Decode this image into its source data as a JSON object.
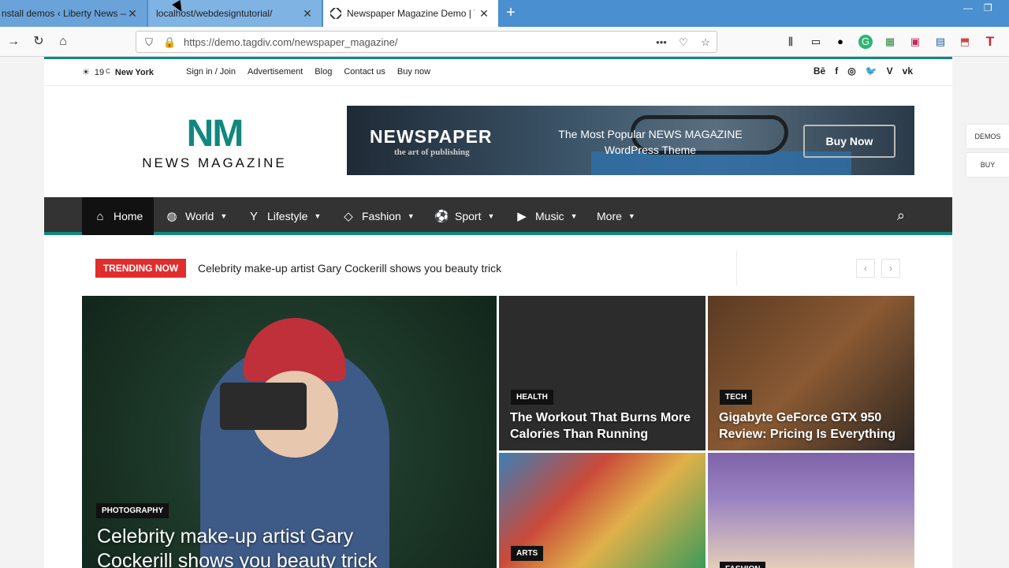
{
  "browser": {
    "tabs": [
      {
        "title": "nstall demos ‹ Liberty News —"
      },
      {
        "title": "localhost/webdesigntutorial/"
      },
      {
        "title": "Newspaper Magazine Demo | T"
      }
    ],
    "new_tab": "+",
    "url_host": "https://demo.tagdiv.com",
    "url_path": "/newspaper_magazine/",
    "url_more": "•••"
  },
  "topbar": {
    "temperature": "19",
    "unit": "C",
    "city": "New York",
    "links": [
      "Sign in / Join",
      "Advertisement",
      "Blog",
      "Contact us",
      "Buy now"
    ],
    "social": [
      "Bē",
      "f",
      "◎",
      "🐦",
      "V",
      "vk"
    ]
  },
  "logo": {
    "mark": "NM",
    "name": "NEWS MAGAZINE"
  },
  "banner": {
    "title": "NEWSPAPER",
    "subtitle": "the art of publishing",
    "tagline_1": "The Most Popular NEWS MAGAZINE",
    "tagline_2": "WordPress Theme",
    "button": "Buy Now"
  },
  "nav": {
    "items": [
      {
        "label": "Home"
      },
      {
        "label": "World"
      },
      {
        "label": "Lifestyle"
      },
      {
        "label": "Fashion"
      },
      {
        "label": "Sport"
      },
      {
        "label": "Music"
      },
      {
        "label": "More"
      }
    ]
  },
  "trending": {
    "label": "TRENDING NOW",
    "headline": "Celebrity make-up artist Gary Cockerill shows you beauty trick"
  },
  "tiles": {
    "big": {
      "category": "PHOTOGRAPHY",
      "title": "Celebrity make-up artist Gary Cockerill shows you beauty trick"
    },
    "health": {
      "category": "HEALTH",
      "title": "The Workout That Burns More Calories Than Running"
    },
    "tech": {
      "category": "TECH",
      "title": "Gigabyte GeForce GTX 950 Review: Pricing Is Everything"
    },
    "arts": {
      "category": "ARTS"
    },
    "fashion": {
      "category": "FASHION"
    }
  },
  "side": {
    "demos": "DEMOS",
    "buy": "BUY"
  },
  "colors": {
    "accent": "#10887f",
    "trending": "#e02d2d",
    "nav_bg": "#333333"
  }
}
